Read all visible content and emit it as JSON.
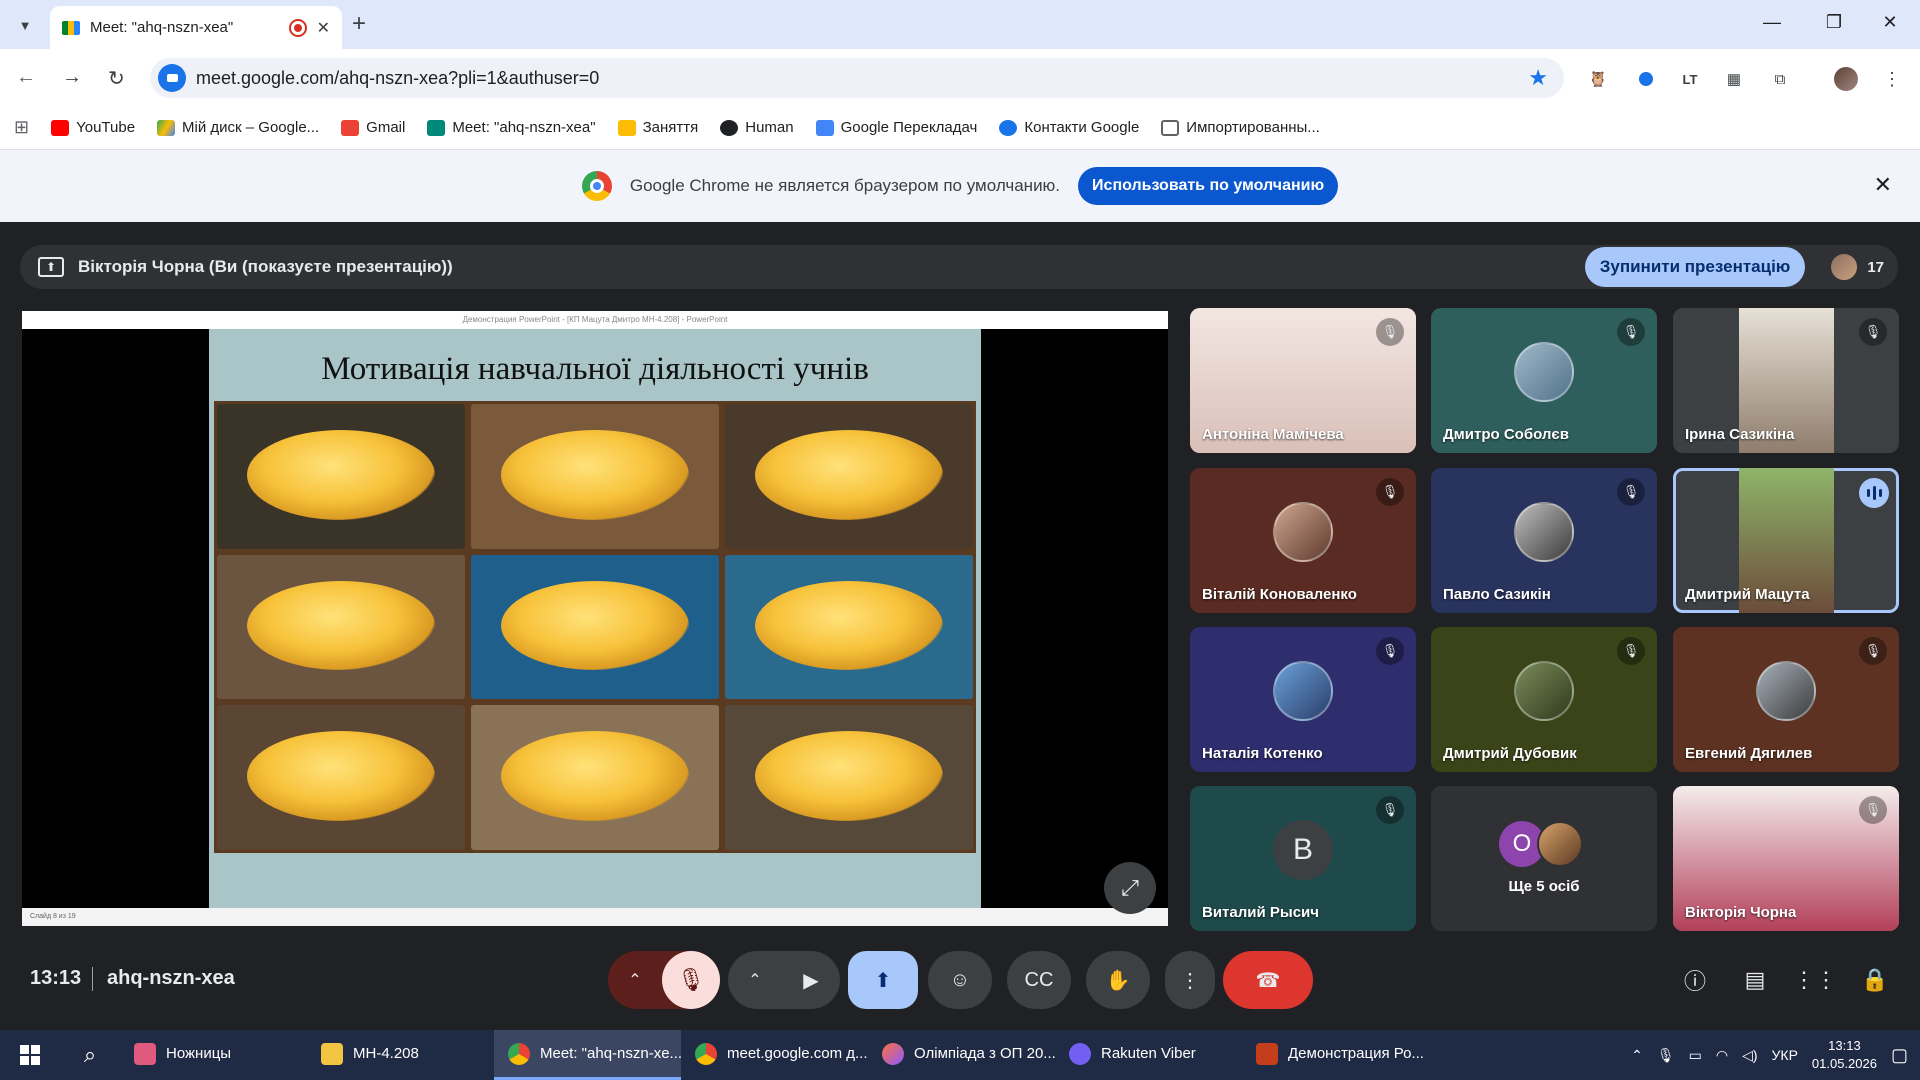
{
  "browser": {
    "tab_title": "Meet: \"ahq-nszn-xea\"",
    "url": "meet.google.com/ahq-nszn-xea?pli=1&authuser=0",
    "bookmarks": [
      {
        "label": "YouTube",
        "color": "#ff0000"
      },
      {
        "label": "Мій диск – Google...",
        "color": "#34a853"
      },
      {
        "label": "Gmail",
        "color": "#ea4335"
      },
      {
        "label": "Meet: \"ahq-nszn-xea\"",
        "color": "#00897b"
      },
      {
        "label": "Заняття",
        "color": "#fbbc04"
      },
      {
        "label": "Human",
        "color": "#202124"
      },
      {
        "label": "Google Перекладач",
        "color": "#4285f4"
      },
      {
        "label": "Контакти Google",
        "color": "#1a73e8"
      },
      {
        "label": "Импортированны...",
        "color": "#5f6368"
      }
    ],
    "infobar_text": "Google Chrome не является браузером по умолчанию.",
    "infobar_button": "Использовать по умолчанию"
  },
  "meet": {
    "presenting_banner": "Вікторія Чорна (Ви (показуєте презентацію))",
    "stop_button": "Зупинити презентацію",
    "participant_count": "17",
    "slide": {
      "window_title": "Демонстрация PowerPoint - [КП Мацута Дмитро МН-4.208] - PowerPoint",
      "status": "Слайд 8 из 19",
      "title": "Мотивація навчальної діяльності учнів"
    },
    "tiles": [
      {
        "name": "Антоніна Мамічева",
        "muted": true
      },
      {
        "name": "Дмитро Соболєв",
        "muted": true
      },
      {
        "name": "Ірина Сазикіна",
        "muted": true
      },
      {
        "name": "Віталій Коноваленко",
        "muted": true
      },
      {
        "name": "Павло Сазикін",
        "muted": true
      },
      {
        "name": "Дмитрий Мацута",
        "speaking": true
      },
      {
        "name": "Наталія Котенко",
        "muted": true
      },
      {
        "name": "Дмитрий Дубовик",
        "muted": true
      },
      {
        "name": "Евгений Дягилев",
        "muted": true
      },
      {
        "name": "Виталий Рысич",
        "muted": true,
        "initial": "В"
      },
      {
        "name": "Ще 5 осіб",
        "initial": "О"
      },
      {
        "name": "Вікторія Чорна",
        "muted": true
      }
    ],
    "time": "13:13",
    "meeting_code": "ahq-nszn-xea"
  },
  "taskbar": {
    "items": [
      {
        "label": "Ножницы",
        "color": "#e05a80",
        "active": false
      },
      {
        "label": "МН-4.208",
        "color": "#f4c542",
        "active": false
      },
      {
        "label": "Meet: \"ahq-nszn-xe...",
        "color": "#4285f4",
        "active": true
      },
      {
        "label": "meet.google.com д...",
        "color": "#4285f4",
        "active": false
      },
      {
        "label": "Олімпіада з ОП 20...",
        "color": "#ff7139",
        "active": false
      },
      {
        "label": "Rakuten Viber",
        "color": "#7360f2",
        "active": false
      },
      {
        "label": "Демонстрация Ро...",
        "color": "#c43e1c",
        "active": false
      }
    ],
    "lang": "УКР",
    "clock_time": "13:13",
    "clock_date": "01.05.2026"
  }
}
